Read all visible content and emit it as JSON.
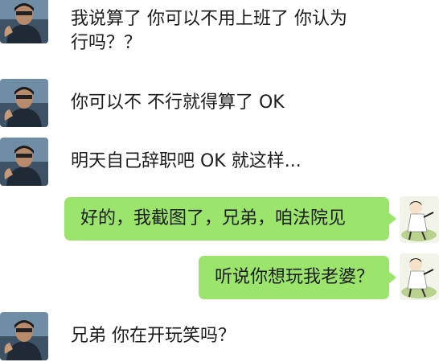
{
  "chat": {
    "messages": [
      {
        "from": "friend",
        "avatar": "friend-avatar-icon",
        "text": "我说算了 你可以不用上班了 你认为\n行吗？？"
      },
      {
        "from": "friend",
        "avatar": "friend-avatar-icon",
        "text": "你可以不 不行就得算了 OK"
      },
      {
        "from": "friend",
        "avatar": "friend-avatar-icon",
        "text": "明天自己辞职吧 OK 就这样..."
      },
      {
        "from": "me",
        "avatar": "cartoon-avatar-icon",
        "text": "好的，我截图了，兄弟，咱法院见"
      },
      {
        "from": "me",
        "avatar": "cartoon-avatar-icon",
        "text": "听说你想玩我老婆？"
      },
      {
        "from": "friend",
        "avatar": "friend-avatar-icon",
        "text": "兄弟 你在开玩笑吗？"
      }
    ]
  },
  "colors": {
    "bubble_outgoing": "#9be56d",
    "background": "#ffffff",
    "text": "#1c1c1c"
  }
}
